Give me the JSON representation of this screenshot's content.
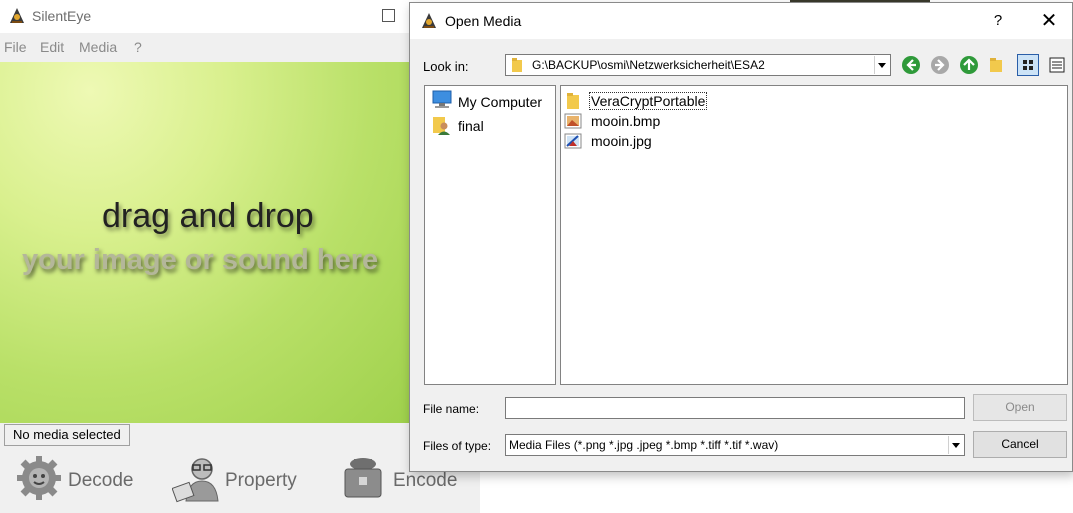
{
  "app": {
    "title": "SilentEye",
    "menu": [
      "File",
      "Edit",
      "Media",
      "?"
    ],
    "drop_line1": "drag and drop",
    "drop_line2": "your image or sound here",
    "status": "No media selected",
    "actions": {
      "decode": "Decode",
      "property": "Property",
      "encode": "Encode"
    }
  },
  "dialog": {
    "title": "Open Media",
    "help": "?",
    "close": "✕",
    "look_in_label": "Look in:",
    "look_in_value": "G:\\BACKUP\\osmi\\Netzwerksicherheit\\ESA2",
    "sidebar": [
      {
        "label": "My Computer",
        "icon": "computer-icon"
      },
      {
        "label": "final",
        "icon": "user-folder-icon"
      }
    ],
    "files": [
      {
        "name": "VeraCryptPortable",
        "icon": "folder-icon",
        "selected": true
      },
      {
        "name": "mooin.bmp",
        "icon": "bmp-image-icon",
        "selected": false
      },
      {
        "name": "mooin.jpg",
        "icon": "jpg-image-icon",
        "selected": false
      }
    ],
    "file_name_label": "File name:",
    "file_name_value": "",
    "open_label": "Open",
    "file_type_label": "Files of type:",
    "file_type_value": "Media Files (*.png *.jpg .jpeg *.bmp *.tiff *.tif *.wav)",
    "cancel_label": "Cancel"
  },
  "colors": {
    "accent_green": "#2f9a3a",
    "drop_green": "#b9e068",
    "selection_blue": "#cce3f7"
  }
}
